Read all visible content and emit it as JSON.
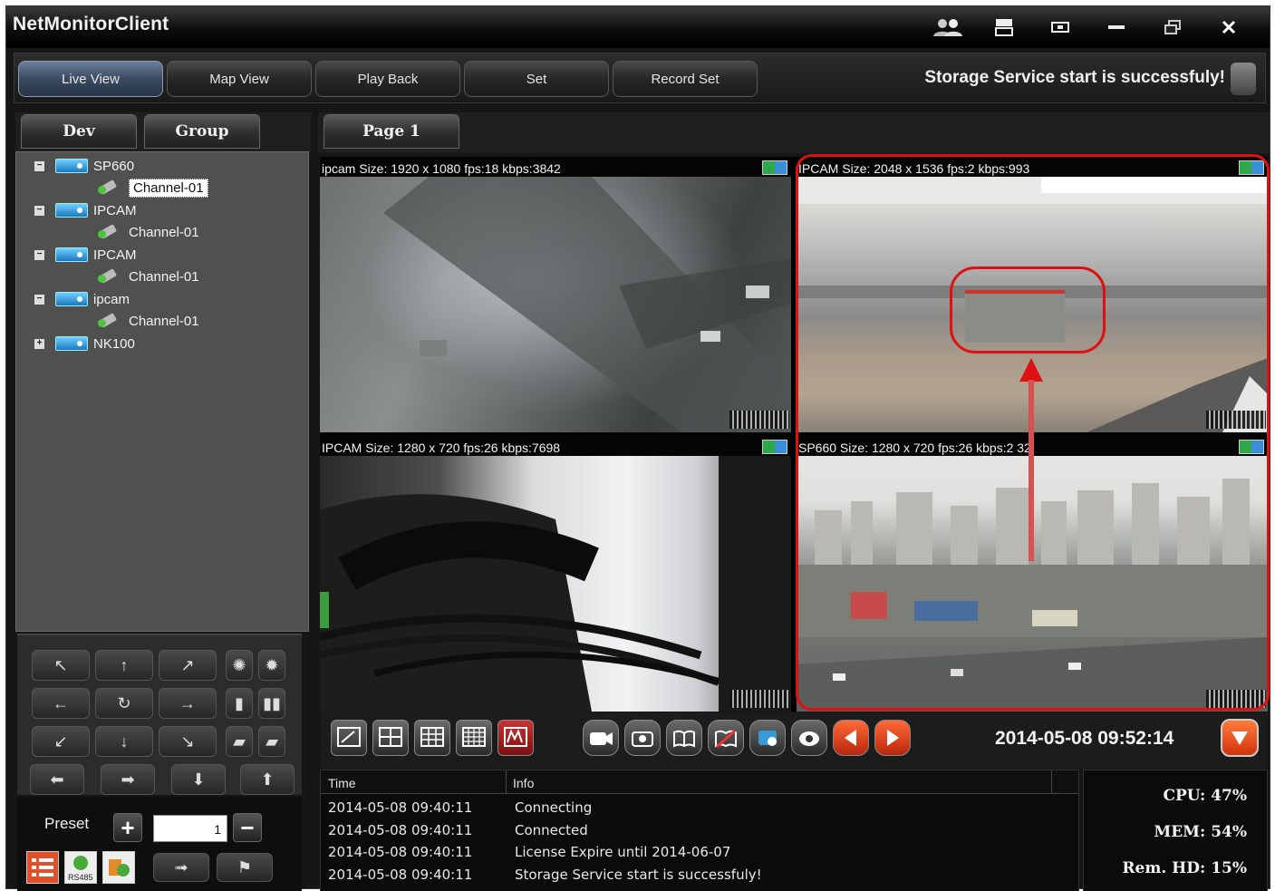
{
  "window": {
    "title": "NetMonitorClient",
    "controls": [
      "users-icon",
      "layout-icon",
      "restore-icon",
      "minimize-icon",
      "maximize-icon",
      "close-icon"
    ]
  },
  "tabs": [
    {
      "label": "Live View",
      "active": true
    },
    {
      "label": "Map View",
      "active": false
    },
    {
      "label": "Play Back",
      "active": false
    },
    {
      "label": "Set",
      "active": false
    },
    {
      "label": "Record Set",
      "active": false
    }
  ],
  "status_message": "Storage Service start is successfuly!",
  "left_tabs": [
    "Dev",
    "Group"
  ],
  "tree": [
    {
      "device": "SP660",
      "expanded": true,
      "channels": [
        "Channel-01"
      ],
      "selected_channel": "Channel-01"
    },
    {
      "device": "IPCAM",
      "expanded": true,
      "channels": [
        "Channel-01"
      ]
    },
    {
      "device": "IPCAM",
      "expanded": true,
      "channels": [
        "Channel-01"
      ]
    },
    {
      "device": "ipcam",
      "expanded": true,
      "channels": [
        "Channel-01"
      ]
    },
    {
      "device": "NK100",
      "expanded": false,
      "channels": []
    }
  ],
  "ptz_buttons": [
    "arrow-up-left-icon",
    "arrow-up-icon",
    "arrow-up-right-icon",
    "focus-near-icon",
    "focus-far-icon",
    "arrow-left-icon",
    "refresh-icon",
    "arrow-right-icon",
    "iris-open-icon",
    "iris-close-icon",
    "arrow-down-left-icon",
    "arrow-down-icon",
    "arrow-down-right-icon",
    "zoom-in-icon",
    "zoom-out-icon"
  ],
  "preset": {
    "label": "Preset",
    "value": "1"
  },
  "page_tab": "Page 1",
  "cameras": [
    {
      "title": "ipcam Size: 1920 x 1080 fps:18 kbps:3842"
    },
    {
      "title": "IPCAM Size: 2048 x 1536 fps:2 kbps:993"
    },
    {
      "title": "IPCAM Size: 1280 x 720 fps:26 kbps:7698"
    },
    {
      "title": "SP660 Size: 1280 x 720 fps:26 kbps:2 32"
    }
  ],
  "datetime": "2014-05-08 09:52:14",
  "log": {
    "columns": [
      "Time",
      "Info"
    ],
    "rows": [
      {
        "time": "2014-05-08 09:40:11",
        "info": "Connecting"
      },
      {
        "time": "2014-05-08 09:40:11",
        "info": "Connected"
      },
      {
        "time": "2014-05-08 09:40:11",
        "info": "License Expire until 2014-06-07"
      },
      {
        "time": "2014-05-08 09:40:11",
        "info": "Storage Service start is successfuly!"
      }
    ]
  },
  "system": {
    "cpu_label": "CPU:",
    "cpu": "47%",
    "mem_label": "MEM:",
    "mem": "54%",
    "hd_label": "Rem. HD:",
    "hd": "15%"
  },
  "colors": {
    "highlight": "#d11111",
    "active_tab": "#3a4a60",
    "panel": "#505050"
  }
}
